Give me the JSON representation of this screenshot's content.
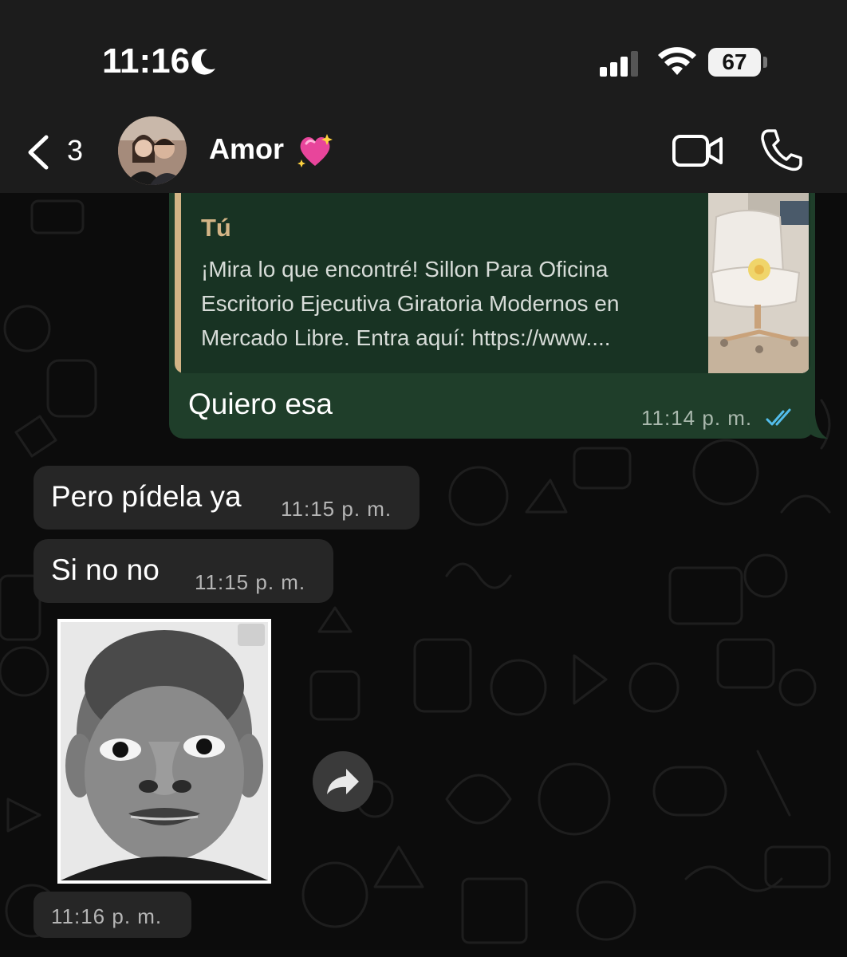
{
  "status_bar": {
    "time": "11:16",
    "battery": "67"
  },
  "header": {
    "back_count": "3",
    "contact_name": "Amor",
    "contact_emoji": "sparkling-heart"
  },
  "messages": {
    "outgoing": {
      "quote_author": "Tú",
      "quote_text": "¡Mira lo que encontré! Sillon Para Oficina Escritorio Ejecutiva Giratoria Modernos en Mercado Libre. Entra aquí: https://www....",
      "text": "Quiero esa",
      "time": "11:14 p. m.",
      "status": "read"
    },
    "incoming": [
      {
        "text": "Pero pídela ya",
        "time": "11:15 p. m."
      },
      {
        "text": "Si no no",
        "time": "11:15 p. m."
      }
    ],
    "sticker": {
      "time": "11:16 p. m."
    }
  },
  "colors": {
    "outgoing_bubble": "#1f3e2a",
    "incoming_bubble": "#262626",
    "quote_accent": "#d3b486",
    "read_ticks": "#53bdeb"
  }
}
